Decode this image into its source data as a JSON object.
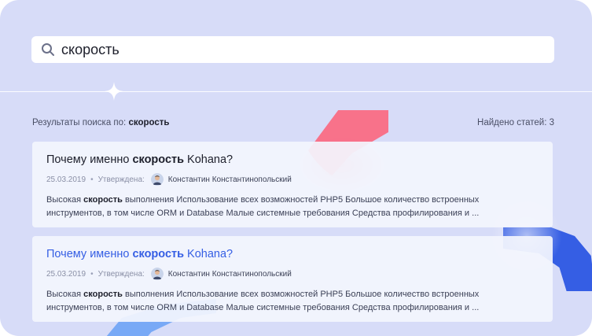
{
  "search": {
    "value": "скорость",
    "icon": "search-icon"
  },
  "results": {
    "prefix": "Результаты поиска по:",
    "query": "скорость",
    "count_text": "Найдено статей: 3"
  },
  "cards": [
    {
      "title_before": "Почему именно ",
      "title_highlight": "скорость",
      "title_after": " Kohana?",
      "date": "25.03.2019",
      "status": "Утверждена:",
      "author": "Константин Константинопольский",
      "snippet_before": "Высокая ",
      "snippet_highlight": "скорость",
      "snippet_after": " выполнения Использование всех возможностей PHP5 Большое количество встроенных инструментов, в том числе ORM и Database Малые системные требования Средства профилирования и ...",
      "state": "default"
    },
    {
      "title_before": "Почему именно ",
      "title_highlight": "скорость",
      "title_after": " Kohana?",
      "date": "25.03.2019",
      "status": "Утверждена:",
      "author": "Константин Константинопольский",
      "snippet_before": "Высокая ",
      "snippet_highlight": "скорость",
      "snippet_after": " выполнения Использование всех возможностей PHP5 Большое количество встроенных инструментов, в том числе ORM и Database Малые системные требования Средства профилирования и ...",
      "state": "hover"
    }
  ],
  "colors": {
    "background": "#d7dcf8",
    "accent": "#355ee4",
    "decor_red": "#fa6b84",
    "decor_light_blue": "#6ea3f5"
  }
}
